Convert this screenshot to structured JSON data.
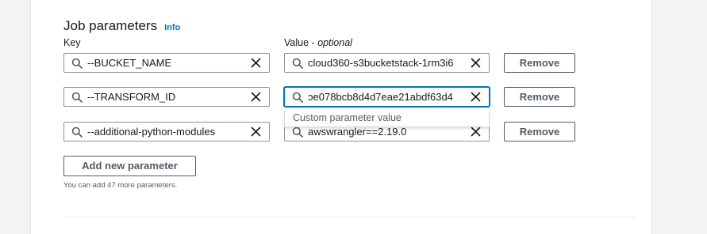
{
  "section": {
    "title": "Job parameters",
    "info_label": "Info",
    "key_label": "Key",
    "value_label": "Value - ",
    "value_optional": "optional"
  },
  "rows": [
    {
      "key": "--BUCKET_NAME",
      "value": "cloud360-s3bucketstack-1rm3i6",
      "remove_label": "Remove"
    },
    {
      "key": "--TRANSFORM_ID",
      "value": "ɔe078bcb8d4d7eae21abdf63d4",
      "remove_label": "Remove"
    },
    {
      "key": "--additional-python-modules",
      "value": "awswrangler==2.19.0",
      "remove_label": "Remove"
    }
  ],
  "dropdown": {
    "option": "Custom parameter value"
  },
  "add_button": {
    "label": "Add new parameter"
  },
  "hint": "You can add 47 more parameters.",
  "icons": {
    "search": "search-icon",
    "clear": "close-icon"
  },
  "colors": {
    "link": "#0073bb",
    "focus": "#0073bb",
    "border": "#879596",
    "button_text": "#545b64"
  }
}
